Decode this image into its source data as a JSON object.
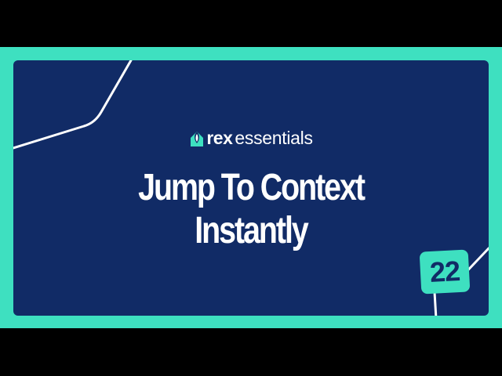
{
  "brand": {
    "logo_icon": "rex-house-leaf-icon",
    "name_bold": "rex",
    "name_regular": "essentials"
  },
  "headline": {
    "line1": "Jump To Context",
    "line2": "Instantly"
  },
  "episode": {
    "number": "22"
  },
  "colors": {
    "background": "#000000",
    "frame": "#3ee0c0",
    "card": "#112b66",
    "text": "#ffffff",
    "accent": "#3ee0c0"
  }
}
